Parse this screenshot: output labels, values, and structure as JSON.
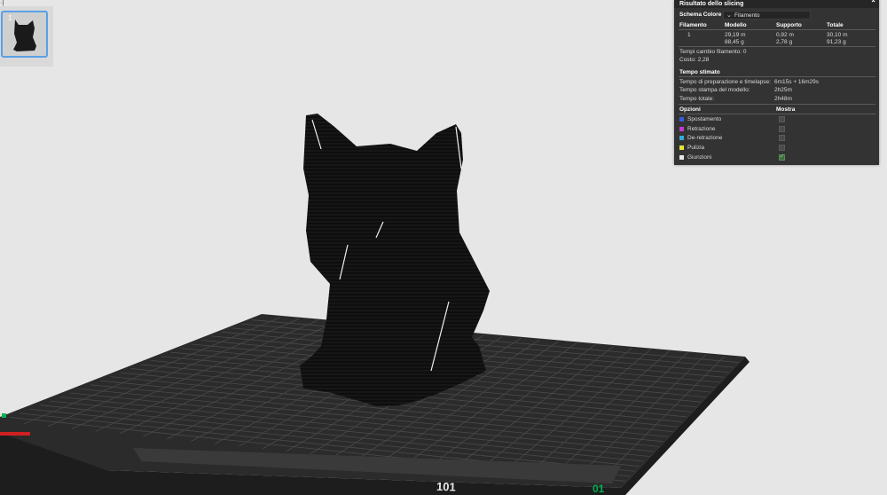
{
  "thumbnail": {
    "index": "1",
    "corner_mark": "·|"
  },
  "panel": {
    "title": "Risultato dello slicing",
    "color_scheme": {
      "label": "Schema Colore",
      "value": "Filamento"
    },
    "table": {
      "headers": [
        "Filamento",
        "Modello",
        "Supporto",
        "Totale"
      ],
      "row": {
        "filament": "1",
        "model": [
          "29,19 m",
          "88,45 g"
        ],
        "support": [
          "0,92 m",
          "2,78 g"
        ],
        "total": [
          "30,10 m",
          "91,23 g"
        ]
      }
    },
    "filament_changes": "Tempi cambio filamento:  0",
    "cost": "Costo:  2,28",
    "estimated_time": {
      "heading": "Tempo stimato",
      "rows": [
        {
          "label": "Tempo di preparazione e timelapse:",
          "value": "6m15s + 16m29s"
        },
        {
          "label": "Tempo stampa del modello:",
          "value": "2h25m"
        },
        {
          "label": "Tempo totale:",
          "value": "2h48m"
        }
      ]
    },
    "options": {
      "headers": [
        "Opzioni",
        "Mostra"
      ],
      "items": [
        {
          "label": "Spostamento",
          "color": "#3b5bd9",
          "checked": false
        },
        {
          "label": "Retrazione",
          "color": "#c23ad0",
          "checked": false
        },
        {
          "label": "De-retrazione",
          "color": "#3aa7d9",
          "checked": false
        },
        {
          "label": "Pulizia",
          "color": "#e6e634",
          "checked": false
        },
        {
          "label": "Giunzioni",
          "color": "#e8e8e8",
          "checked": true
        }
      ]
    }
  },
  "plate": {
    "label_front": "101",
    "label_corner": "01",
    "accent_green": "#00b050",
    "axis_red": "#d02020"
  }
}
